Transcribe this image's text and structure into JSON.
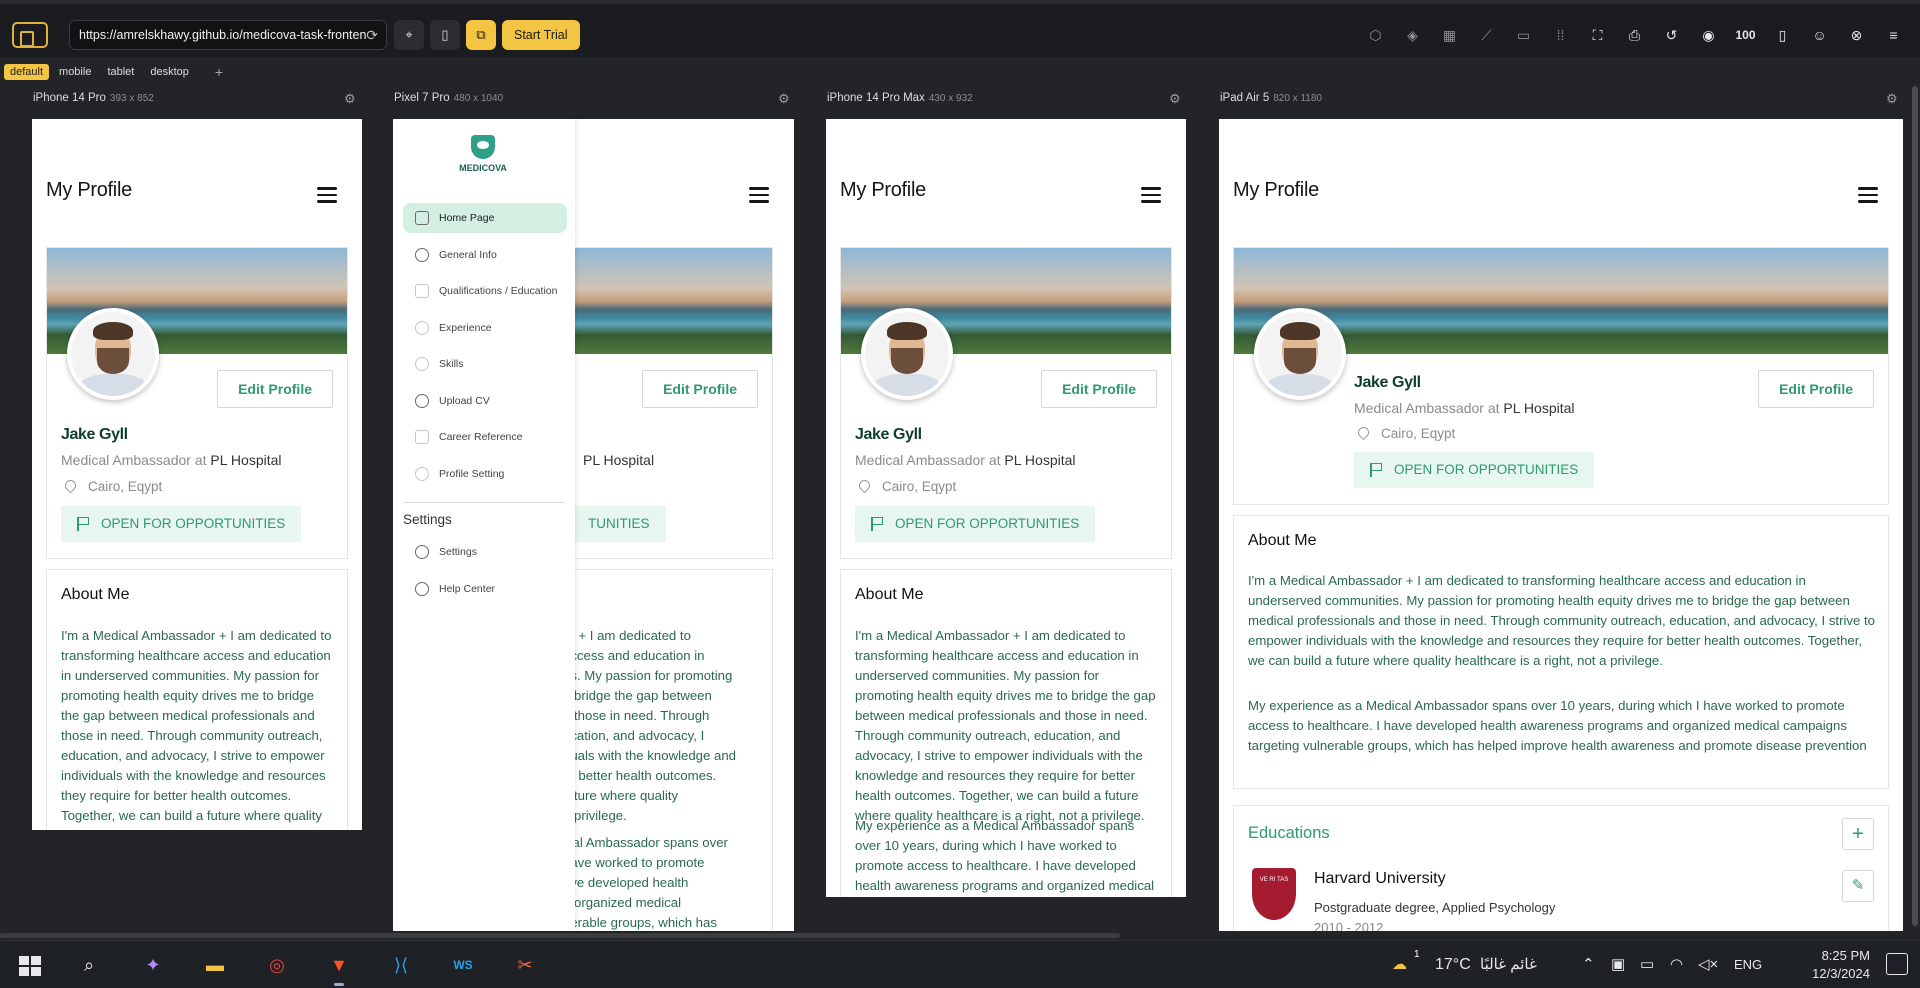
{
  "toolbar": {
    "url": "https://amrelskhawy.github.io/medicova-task-fronten",
    "start_trial": "Start Trial",
    "zoom": "100",
    "icons": [
      "cube-icon",
      "layers-icon",
      "grid-icon",
      "ruler-icon",
      "rectangle-icon",
      "dots-grid-icon",
      "screenshot-icon",
      "printer-icon",
      "refresh-icon",
      "camera-icon",
      "zoom-level",
      "mobile-rotate-icon",
      "discord-icon",
      "close-circle-icon",
      "menu-icon"
    ]
  },
  "preset_tabs": [
    "default",
    "mobile",
    "tablet",
    "desktop"
  ],
  "devices": [
    {
      "name": "iPhone 14 Pro",
      "dims": "393 x 852"
    },
    {
      "name": "Pixel 7 Pro",
      "dims": "480 x 1040"
    },
    {
      "name": "iPhone 14 Pro Max",
      "dims": "430 x 932"
    },
    {
      "name": "iPad Air 5",
      "dims": "820 x 1180"
    }
  ],
  "page": {
    "title": "My Profile",
    "edit_button": "Edit Profile",
    "name": "Jake Gyll",
    "role_prefix": "Medical Ambassador at",
    "role_org": "PL Hospital",
    "location": "Cairo, Eqypt",
    "opportunities": "OPEN FOR OPPORTUNITIES",
    "opportunities_cut": "TUNITIES",
    "role_cut": "PL Hospital",
    "about_title": "About Me",
    "about_1": "I'm a Medical Ambassador + I am dedicated to transforming healthcare access and education in underserved communities. My passion for promoting health equity drives me to bridge the gap between medical professionals and those in need. Through community outreach, education, and advocacy, I strive to empower individuals with the knowledge and resources they require for better health outcomes. Together, we can build a future where quality healthcare is a right, not a privilege.",
    "about_2": "My experience as a Medical Ambassador spans over 10 years, during which I have worked to promote access to healthcare. I have developed health awareness programs and organized medical campaigns targeting vulnerable groups, which has helped improve health awareness and promote disease prevention",
    "educations_title": "Educations",
    "edu_uni": "Harvard University",
    "edu_degree": "Postgraduate degree, Applied Psychology",
    "edu_years": "2010 - 2012"
  },
  "pixel_cut": {
    "lines_1": [
      "or + I am dedicated to",
      "access and education in",
      "es. My passion for promoting",
      "o bridge the gap between",
      "d those in need. Through",
      "ucation, and advocacy, I",
      "duals with the knowledge and",
      "or better health outcomes.",
      "future where quality",
      "a privilege."
    ],
    "lines_2": [
      "ical Ambassador spans over",
      "have worked to promote",
      "ave developed health",
      "d organized medical",
      "nerable groups, which has"
    ]
  },
  "sidebar": {
    "logo": "MEDICOVA",
    "items": [
      "Home Page",
      "General Info",
      "Qualifications / Education",
      "Experience",
      "Skills",
      "Upload CV",
      "Career Reference",
      "Profile Setting"
    ],
    "settings_heading": "Settings",
    "settings_items": [
      "Settings",
      "Help Center"
    ]
  },
  "taskbar": {
    "weather_temp": "17°C",
    "weather_text": "غائم غالبًا",
    "weather_badge": "1",
    "lang": "ENG",
    "time": "8:25 PM",
    "date": "12/3/2024",
    "notif_count": "1"
  }
}
